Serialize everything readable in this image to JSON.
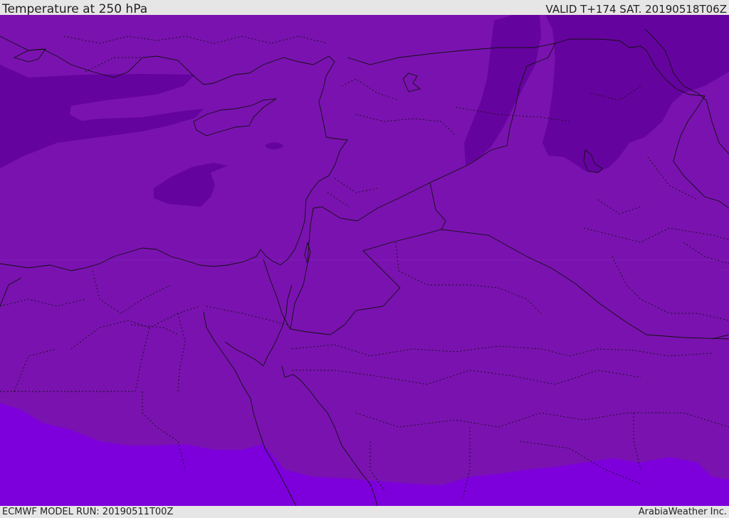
{
  "header": {
    "title": "Temperature at 250 hPa",
    "valid": "VALID T+174 SAT. 20190518T06Z"
  },
  "footer": {
    "model_run": "ECMWF MODEL RUN: 20190511T00Z",
    "credit": "ArabiaWeather Inc."
  },
  "map": {
    "colors": {
      "base": "#7a12b0",
      "cold": "#65039f",
      "warm": "#7d00dc",
      "border": "#111111"
    }
  }
}
